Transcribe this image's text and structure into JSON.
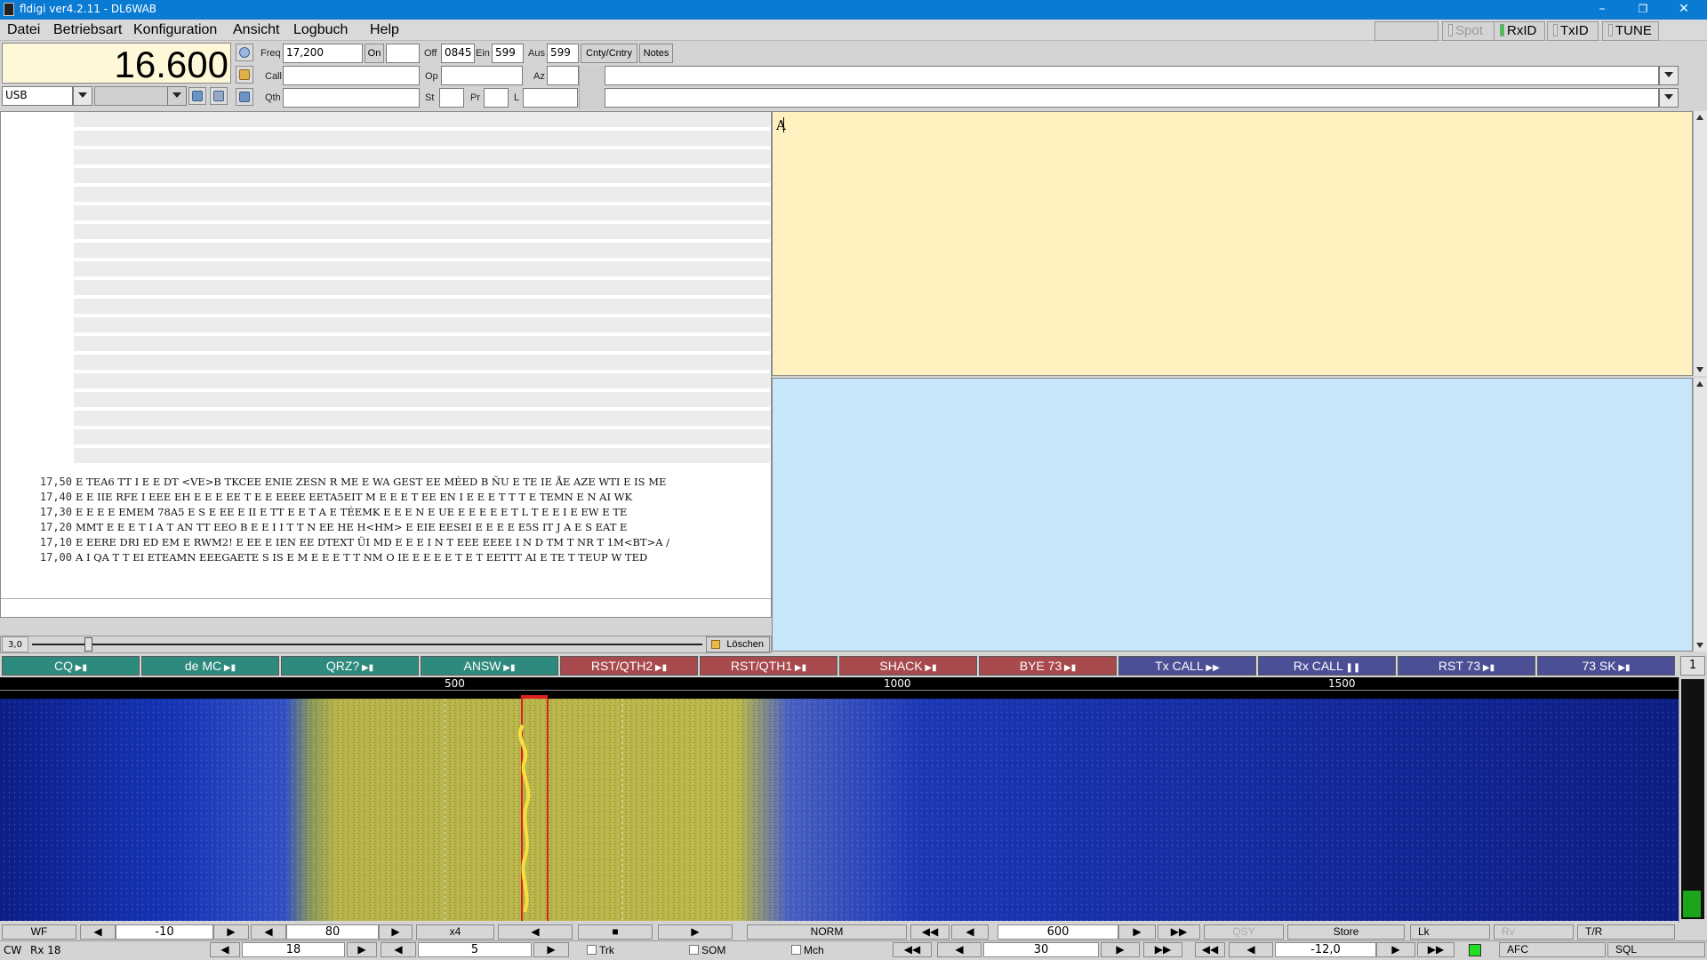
{
  "window": {
    "title": "fldigi ver4.2.11 - DL6WAB"
  },
  "menu": [
    "Datei",
    "Betriebsart",
    "Konfiguration",
    "Ansicht",
    "Logbuch",
    "Help"
  ],
  "toggles": {
    "spot": "Spot",
    "rxid": "RxID",
    "txid": "TxID",
    "tune": "TUNE"
  },
  "rig": {
    "freq_display": "16.600",
    "mode": "USB"
  },
  "log": {
    "freq_label": "Freq",
    "freq_value": "17,200",
    "on_label": "On",
    "off_label": "Off",
    "off_value": "0845",
    "ein_label": "Ein",
    "ein_value": "599",
    "aus_label": "Aus",
    "aus_value": "599",
    "cnty_button": "Cnty/Cntry",
    "notes_button": "Notes",
    "call_label": "Call",
    "op_label": "Op",
    "az_label": "Az",
    "qth_label": "Qth",
    "st_label": "St",
    "pr_label": "Pr",
    "l_label": "L"
  },
  "rx_text": {
    "rows": [
      {
        "freq": "17,50",
        "text": "E TEA6 TT I E E DT <VE>B TKCEE ENIE ZESN R ME E WA GEST EE MÉED B ÑU  E TE IE ÅE AZE WTI E IS ME"
      },
      {
        "freq": "17,40",
        "text": "E E IIE RFE I EEE EH E E E EE T E E EEEE EETA5EIT M E E E T EE EN I E E E T T T E TEMN E N AI WK"
      },
      {
        "freq": "17,30",
        "text": "E E E E EMEM 78A5 E S E EE E II E TT E E T A E TÉEMK E E E N E UE E E E E E T L T E E I E EW E TE"
      },
      {
        "freq": "17,20",
        "text": "MMT E E E T I A T AN TT EEO B E E I I T T N EE HE H<HM> E EIE EESEI  E E E E E5S IT J A E S EAT E"
      },
      {
        "freq": "17,10",
        "text": "E EERE DRI ED EM E RWM2! E EE E IEN EE DTEXT ÜI MD E E E I N T EEE EEEE I N D TM T NR T 1M<BT>A /"
      },
      {
        "freq": "17,00",
        "text": "A I QA T T EI ETEAMN EEEGAETE S IS E M E E E T T NM O IE E E E E T E T EETTT AI E TE T TEUP W TED"
      }
    ],
    "slider_value": "3,0",
    "clear_button": "Löschen"
  },
  "rx_panel": {
    "text": "A"
  },
  "macros": [
    {
      "label": "CQ",
      "color": "#2f8a7e"
    },
    {
      "label": "de MC",
      "color": "#2f8a7e"
    },
    {
      "label": "QRZ?",
      "color": "#2f8a7e"
    },
    {
      "label": "ANSW",
      "color": "#2f8a7e"
    },
    {
      "label": "RST/QTH2",
      "color": "#a84a4d"
    },
    {
      "label": "RST/QTH1",
      "color": "#a84a4d"
    },
    {
      "label": "SHACK",
      "color": "#a84a4d"
    },
    {
      "label": "BYE 73",
      "color": "#a84a4d"
    },
    {
      "label": "Tx CALL",
      "color": "#4b4f95"
    },
    {
      "label": "Rx CALL",
      "color": "#4b4f95"
    },
    {
      "label": "RST 73",
      "color": "#4b4f95"
    },
    {
      "label": "73 SK",
      "color": "#4b4f95"
    }
  ],
  "macro_set": "1",
  "waterfall": {
    "scale_labels": [
      "500",
      "1000",
      "1500"
    ]
  },
  "wf_controls": {
    "wf_button": "WF",
    "ref_level": "-10",
    "range": "80",
    "zoom": "x4",
    "speed": "NORM",
    "carrier": "600",
    "qsy": "QSY",
    "store": "Store",
    "lk": "Lk",
    "rv": "Rv",
    "tr": "T/R"
  },
  "status_bar": {
    "mode": "CW",
    "rx_status": "Rx 18",
    "value1": "18",
    "value2": "5",
    "trk": "Trk",
    "som": "SOM",
    "mch": "Mch",
    "value3": "30",
    "value4": "-12,0",
    "afc": "AFC",
    "sql": "SQL"
  }
}
